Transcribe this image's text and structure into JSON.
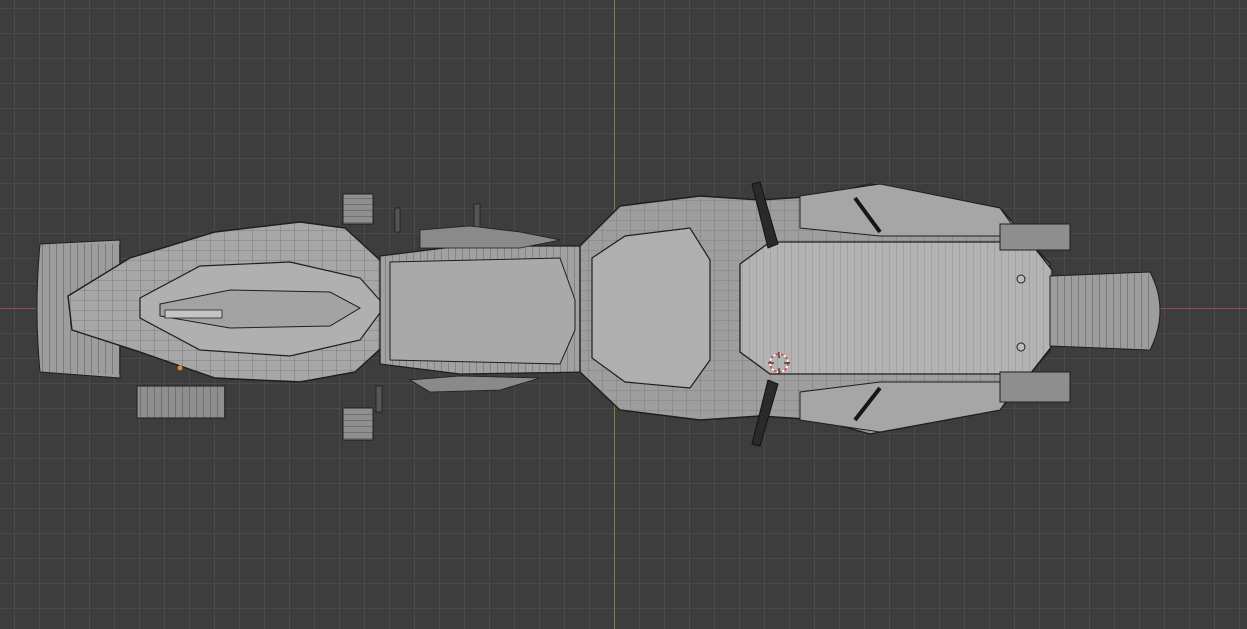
{
  "viewport": {
    "view": "top-orthographic",
    "mode": "wireframe-overlay-solid",
    "colors": {
      "background": "#3d3d3d",
      "grid": "#4a4a4a",
      "x_axis": "#9a4a4a",
      "y_axis": "#6f8a2e",
      "mesh": "#9c9c9c",
      "wire": "#1e1e1e",
      "origin": "#e08a2a"
    },
    "icons": {
      "cursor": "3d-cursor-icon",
      "origin": "object-origin-icon"
    }
  }
}
